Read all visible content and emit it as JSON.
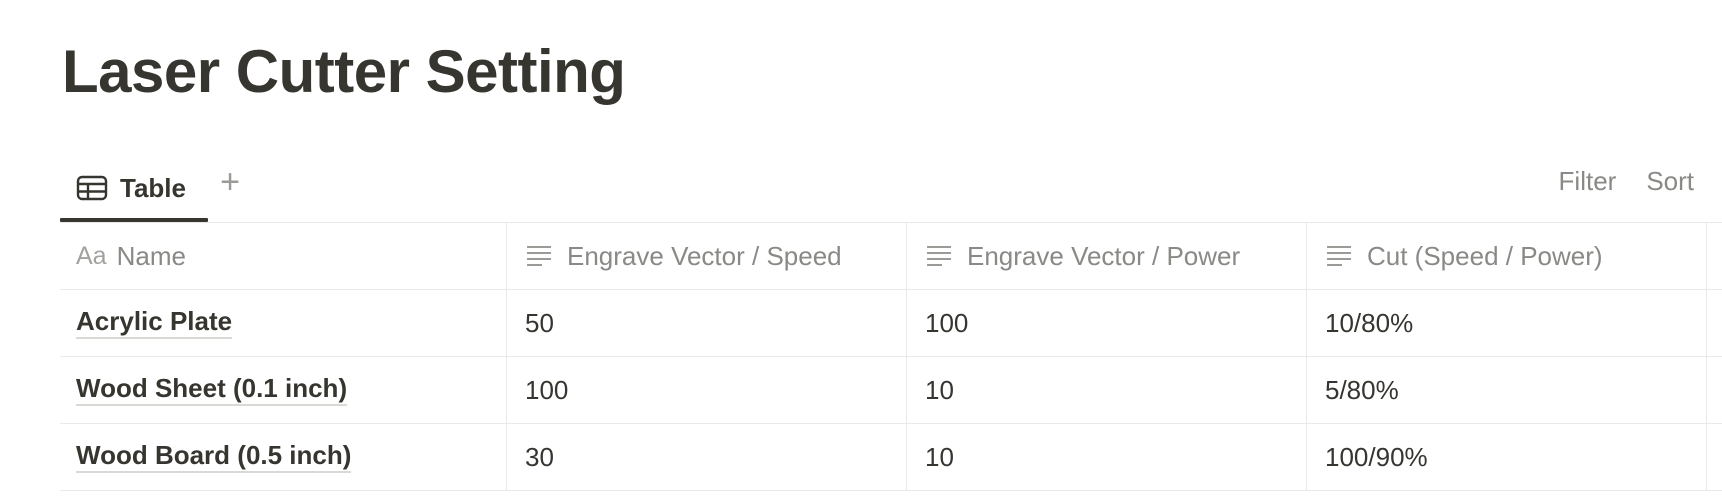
{
  "page": {
    "title": "Laser Cutter Setting"
  },
  "viewbar": {
    "tab_label": "Table",
    "add_view_symbol": "+",
    "filter_label": "Filter",
    "sort_label": "Sort"
  },
  "table": {
    "columns": [
      {
        "prefix": "Aa",
        "label": "Name"
      },
      {
        "label": "Engrave Vector / Speed"
      },
      {
        "label": "Engrave Vector / Power"
      },
      {
        "label": "Cut (Speed / Power)"
      }
    ],
    "rows": [
      {
        "name": "Acrylic Plate",
        "speed": "50",
        "power": "100",
        "cut": "10/80%"
      },
      {
        "name": "Wood Sheet (0.1 inch)",
        "speed": "100",
        "power": "10",
        "cut": "5/80%"
      },
      {
        "name": "Wood Board (0.5 inch)",
        "speed": "30",
        "power": "10",
        "cut": "100/90%"
      }
    ]
  },
  "icons": {
    "tab": "table-icon",
    "column_text": "text-lines-icon"
  }
}
